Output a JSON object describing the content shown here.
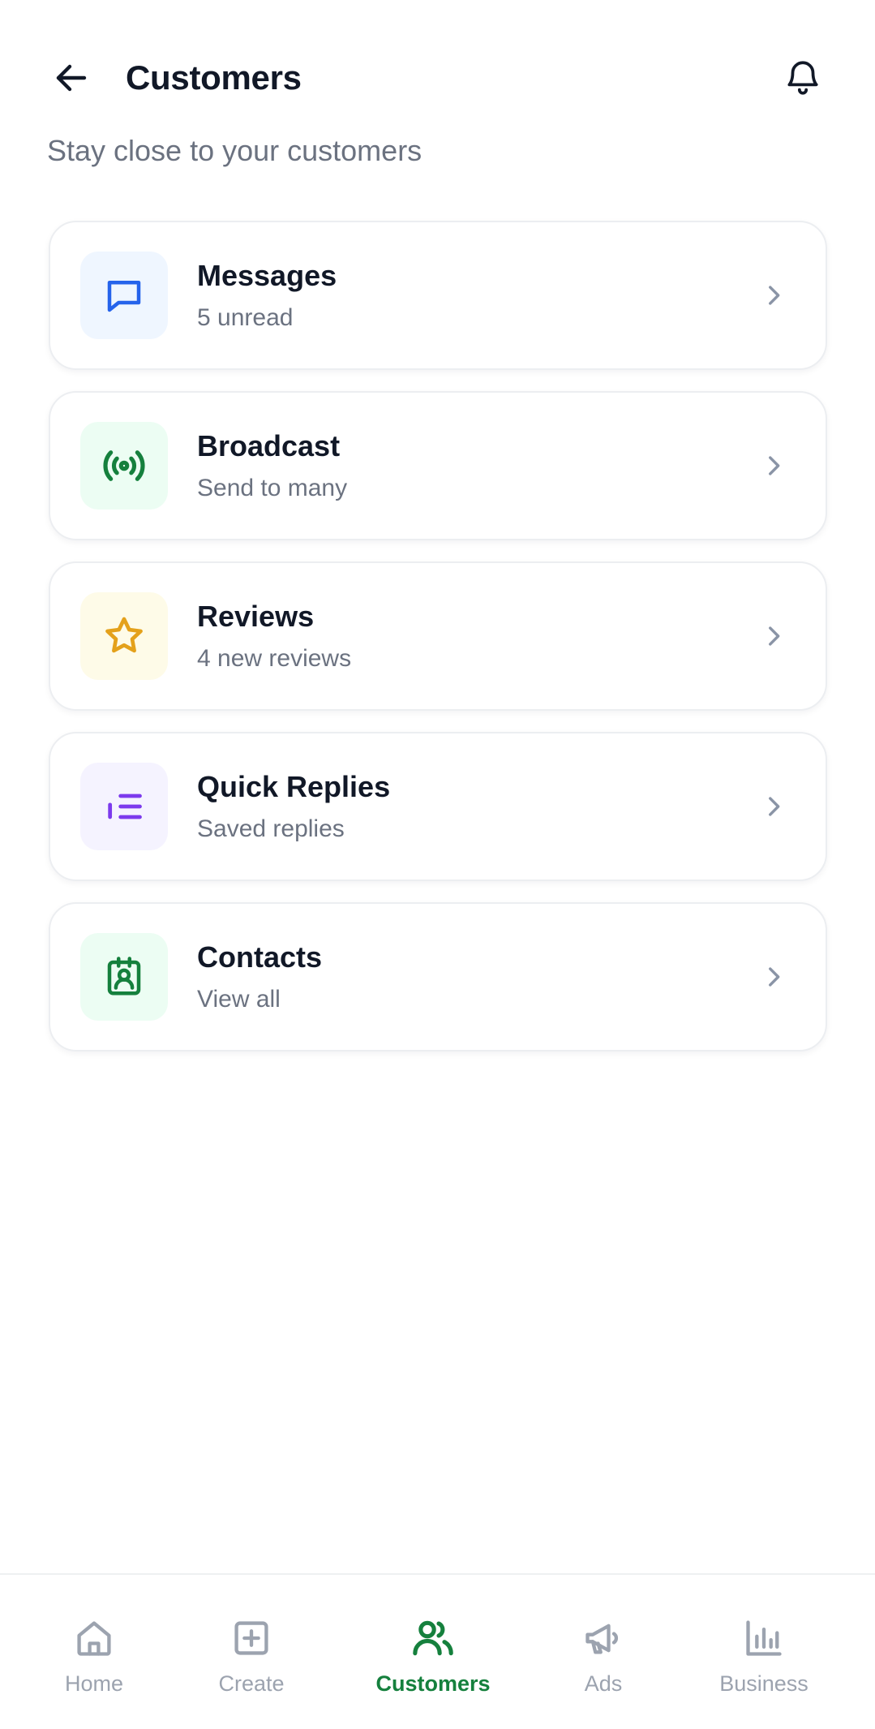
{
  "header": {
    "title": "Customers",
    "subtitle": "Stay close to your customers"
  },
  "cards": [
    {
      "title": "Messages",
      "subtitle": "5 unread",
      "icon": "chat-bubble-icon",
      "icon_color": "#2563eb",
      "tile_color": "#eff6ff"
    },
    {
      "title": "Broadcast",
      "subtitle": "Send to many",
      "icon": "broadcast-icon",
      "icon_color": "#15803d",
      "tile_color": "#ecfdf3"
    },
    {
      "title": "Reviews",
      "subtitle": "4 new reviews",
      "icon": "star-icon",
      "icon_color": "#e4a11b",
      "tile_color": "#fefbe8"
    },
    {
      "title": "Quick Replies",
      "subtitle": "Saved replies",
      "icon": "list-icon",
      "icon_color": "#7c3aed",
      "tile_color": "#f5f3ff"
    },
    {
      "title": "Contacts",
      "subtitle": "View all",
      "icon": "contact-card-icon",
      "icon_color": "#15803d",
      "tile_color": "#ecfdf3"
    }
  ],
  "bottom_nav": {
    "items": [
      {
        "label": "Home",
        "icon": "home-icon",
        "active": false
      },
      {
        "label": "Create",
        "icon": "plus-square-icon",
        "active": false
      },
      {
        "label": "Customers",
        "icon": "users-icon",
        "active": true
      },
      {
        "label": "Ads",
        "icon": "megaphone-icon",
        "active": false
      },
      {
        "label": "Business",
        "icon": "bar-chart-icon",
        "active": false
      }
    ],
    "active_color": "#15803d",
    "inactive_color": "#9ca3af"
  }
}
